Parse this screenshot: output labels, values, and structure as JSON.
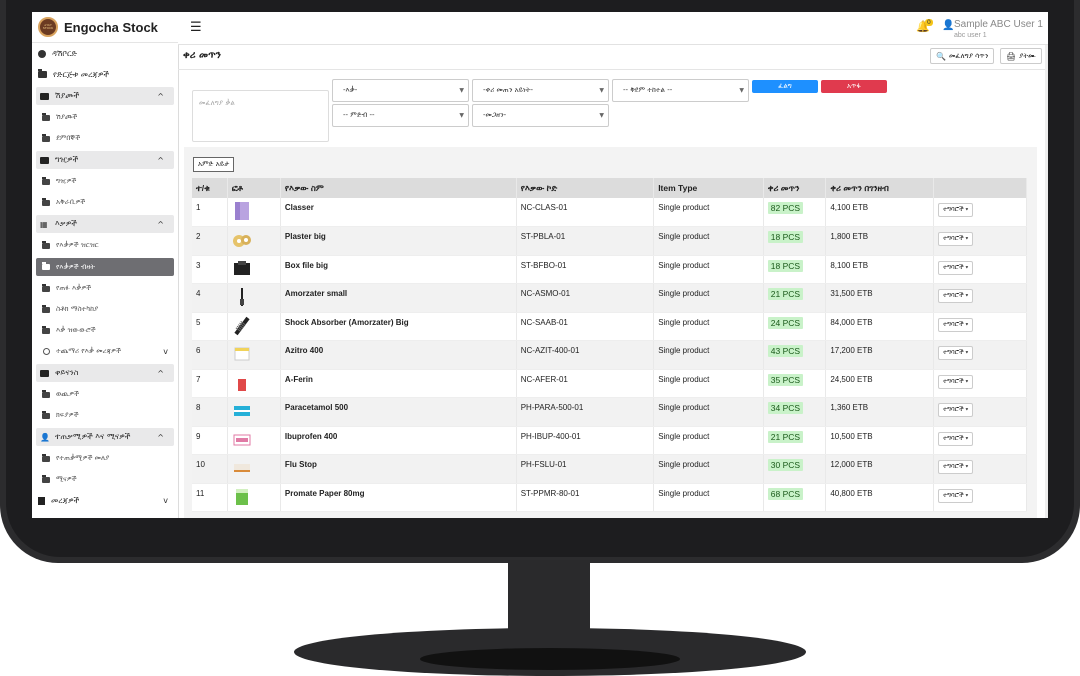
{
  "app": {
    "name": "Engocha Stock",
    "logo_text": "እንጎቻ STOCK"
  },
  "sidebar": {
    "items": [
      {
        "label": "ዳሽቦርድ",
        "icon": "dashboard-icon",
        "type": "item"
      },
      {
        "label": "የድርጅቱ መረጃዎች",
        "icon": "folder-icon",
        "type": "item"
      },
      {
        "label": "ሽያጮች",
        "icon": "cash-register-icon",
        "type": "section",
        "chevron": "^"
      },
      {
        "label": "ሽያጮች",
        "icon": "folder-icon",
        "type": "sub"
      },
      {
        "label": "ደምበኞች",
        "icon": "folder-icon",
        "type": "sub"
      },
      {
        "label": "ግዢዎች",
        "icon": "cash-register-icon",
        "type": "section",
        "chevron": "^"
      },
      {
        "label": "ግዢዎች",
        "icon": "folder-icon",
        "type": "sub"
      },
      {
        "label": "አቅራቢዎች",
        "icon": "folder-icon",
        "type": "sub"
      },
      {
        "label": "እቃዎች",
        "icon": "boxes-icon",
        "type": "section",
        "chevron": "^"
      },
      {
        "label": "የእቃዎች ዝርዝር",
        "icon": "folder-icon",
        "type": "sub"
      },
      {
        "label": "የእቃዎች ብዛት",
        "icon": "folder-icon",
        "type": "active"
      },
      {
        "label": "የጠፉ እቃዎች",
        "icon": "folder-icon",
        "type": "sub"
      },
      {
        "label": "ስቶክ ማስተካከያ",
        "icon": "folder-icon",
        "type": "sub"
      },
      {
        "label": "እቃ ዝውውሮች",
        "icon": "folder-icon",
        "type": "sub"
      },
      {
        "label": "ተጨማሪ የእቃ መረጃዎች",
        "icon": "circle-icon",
        "type": "sub",
        "chevron": "v"
      },
      {
        "label": "ቀይናንስ",
        "icon": "cash-register-icon",
        "type": "section",
        "chevron": "^"
      },
      {
        "label": "ወጪዎች",
        "icon": "folder-icon",
        "type": "sub"
      },
      {
        "label": "ክፍያዎች",
        "icon": "folder-icon",
        "type": "sub"
      },
      {
        "label": "ተጠቃሚዎች እና ሚናዎች",
        "icon": "user-icon",
        "type": "section",
        "chevron": "^"
      },
      {
        "label": "የተጠቃሚዎች መለያ",
        "icon": "folder-icon",
        "type": "sub"
      },
      {
        "label": "ሚናዎች",
        "icon": "folder-icon",
        "type": "sub"
      },
      {
        "label": "መረጃዎች",
        "icon": "book-icon",
        "type": "item",
        "chevron": "v"
      }
    ]
  },
  "topbar": {
    "user_name": "Sample ABC User 1",
    "user_sub": "abc user 1",
    "notif_count": "0"
  },
  "page": {
    "title": "ቀሪ መጥን",
    "search_button": "መፈለግያ ሳጥን",
    "print_button": "ያትሙ"
  },
  "filters": {
    "search_placeholder": "መፈለግያ ቃል",
    "item": "-እቃ-",
    "item_type": "-ቀሪ መጠን አይነት-",
    "sort": "-- ቅደም ተከተል --",
    "category": "-- ምድብ --",
    "sub_category": "-መጋዘን-",
    "search_btn": "ፈልግ",
    "clear_btn": "አጥፋ"
  },
  "table": {
    "columns_button": "አምድ አይታ",
    "headers": [
      "ተ/ቁ",
      "ፎቶ",
      "የእቃው ስም",
      "የእቃው ኮድ",
      "Item Type",
      "ቀሪ መጥን",
      "ቀሪ መጥን በገንዘብ",
      ""
    ],
    "action_label": "ተግባሮች",
    "rows": [
      {
        "no": "1",
        "name": "Classer",
        "code": "NC-CLAS-01",
        "type": "Single product",
        "qty": "82 PCS",
        "value": "4,100 ETB",
        "thumb": "box-lavender"
      },
      {
        "no": "2",
        "name": "Plaster big",
        "code": "ST-PBLA-01",
        "type": "Single product",
        "qty": "18 PCS",
        "value": "1,800 ETB",
        "thumb": "tape-rolls"
      },
      {
        "no": "3",
        "name": "Box file big",
        "code": "ST-BFBO-01",
        "type": "Single product",
        "qty": "18 PCS",
        "value": "8,100 ETB",
        "thumb": "box-file"
      },
      {
        "no": "4",
        "name": "Amorzater small",
        "code": "NC-ASMO-01",
        "type": "Single product",
        "qty": "21 PCS",
        "value": "31,500 ETB",
        "thumb": "shock-small"
      },
      {
        "no": "5",
        "name": "Shock Absorber (Amorzater) Big",
        "code": "NC-SAAB-01",
        "type": "Single product",
        "qty": "24 PCS",
        "value": "84,000 ETB",
        "thumb": "shock-big"
      },
      {
        "no": "6",
        "name": "Azitro 400",
        "code": "NC-AZIT-400-01",
        "type": "Single product",
        "qty": "43 PCS",
        "value": "17,200 ETB",
        "thumb": "medicine-box"
      },
      {
        "no": "7",
        "name": "A-Ferin",
        "code": "NC-AFER-01",
        "type": "Single product",
        "qty": "35 PCS",
        "value": "24,500 ETB",
        "thumb": "red-pack"
      },
      {
        "no": "8",
        "name": "Paracetamol 500",
        "code": "PH-PARA-500-01",
        "type": "Single product",
        "qty": "34 PCS",
        "value": "1,360 ETB",
        "thumb": "blue-pack"
      },
      {
        "no": "9",
        "name": "Ibuprofen 400",
        "code": "PH-IBUP-400-01",
        "type": "Single product",
        "qty": "21 PCS",
        "value": "10,500 ETB",
        "thumb": "pink-pack"
      },
      {
        "no": "10",
        "name": "Flu Stop",
        "code": "PH-FSLU-01",
        "type": "Single product",
        "qty": "30 PCS",
        "value": "12,000 ETB",
        "thumb": "white-pack"
      },
      {
        "no": "11",
        "name": "Promate Paper 80mg",
        "code": "ST-PPMR-80-01",
        "type": "Single product",
        "qty": "68 PCS",
        "value": "40,800 ETB",
        "thumb": "green-ream"
      }
    ]
  },
  "colors": {
    "accent_blue": "#1e90ff",
    "danger_red": "#e03a4e",
    "qty_green": "#c9f2c9",
    "bezel": "#2c2c2e"
  }
}
